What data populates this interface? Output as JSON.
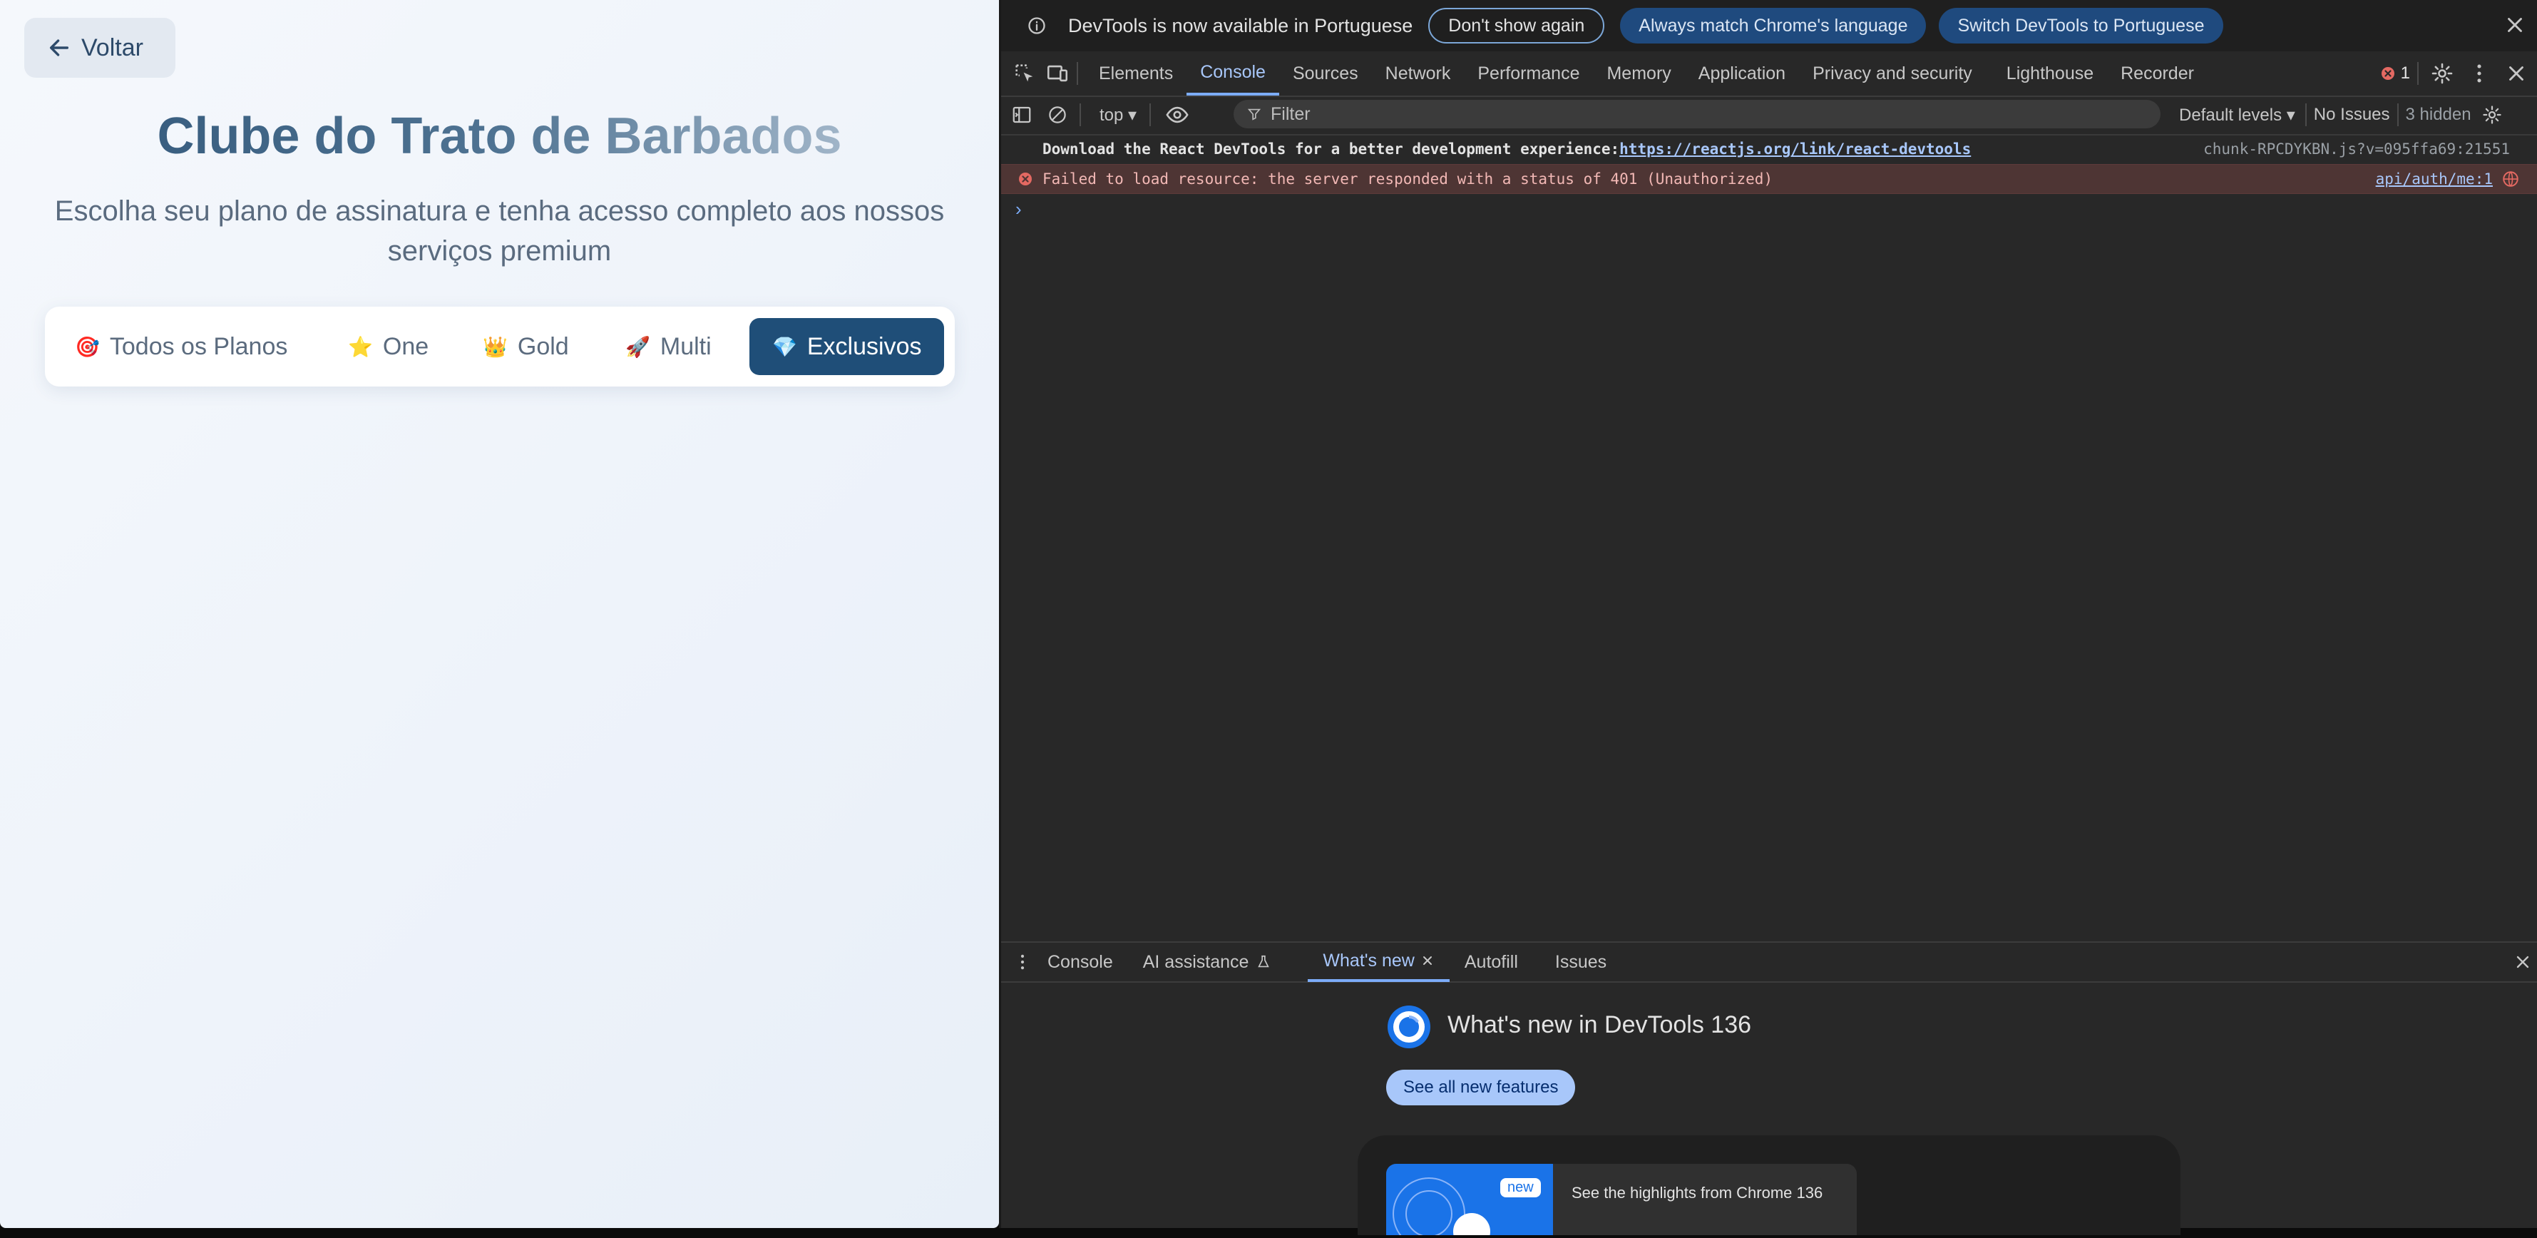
{
  "app": {
    "back_label": "Voltar",
    "title": "Clube do Trato de Barbados",
    "subtitle": "Escolha seu plano de assinatura e tenha acesso completo aos nossos serviços premium",
    "plan_tabs": [
      {
        "emoji": "🎯",
        "label": "Todos os Planos"
      },
      {
        "emoji": "⭐",
        "label": "One"
      },
      {
        "emoji": "👑",
        "label": "Gold"
      },
      {
        "emoji": "🚀",
        "label": "Multi"
      },
      {
        "emoji": "💎",
        "label": "Exclusivos",
        "active": true
      }
    ],
    "colors": {
      "accent": "#1f4e78",
      "text_muted": "#5b6b7e"
    }
  },
  "devtools": {
    "infobar": {
      "message": "DevTools is now available in Portuguese",
      "dont_show": "Don't show again",
      "match_lang": "Always match Chrome's language",
      "switch_lang": "Switch DevTools to Portuguese"
    },
    "tabs": [
      "Elements",
      "Console",
      "Sources",
      "Network",
      "Performance",
      "Memory",
      "Application",
      "Privacy and security",
      "Lighthouse",
      "Recorder"
    ],
    "active_tab": "Console",
    "error_count": "1",
    "toolbar": {
      "context": "top",
      "filter_placeholder": "Filter",
      "levels": "Default levels",
      "issues": "No Issues",
      "hidden": "3 hidden"
    },
    "console": {
      "log_text": "Download the React DevTools for a better development experience: ",
      "log_link": "https://reactjs.org/link/react-devtools",
      "log_source": "chunk-RPCDYKBN.js?v=095ffa69:21551",
      "error_text": "Failed to load resource: the server responded with a status of 401 (Unauthorized)",
      "error_source": "api/auth/me:1"
    },
    "drawer": {
      "tabs": [
        "Console",
        "AI assistance",
        "What's new",
        "Autofill",
        "Issues"
      ],
      "active": "What's new",
      "whats_new_title": "What's new in DevTools 136",
      "see_all": "See all new features",
      "badge": "new",
      "highlight": "See the highlights from Chrome 136"
    }
  }
}
